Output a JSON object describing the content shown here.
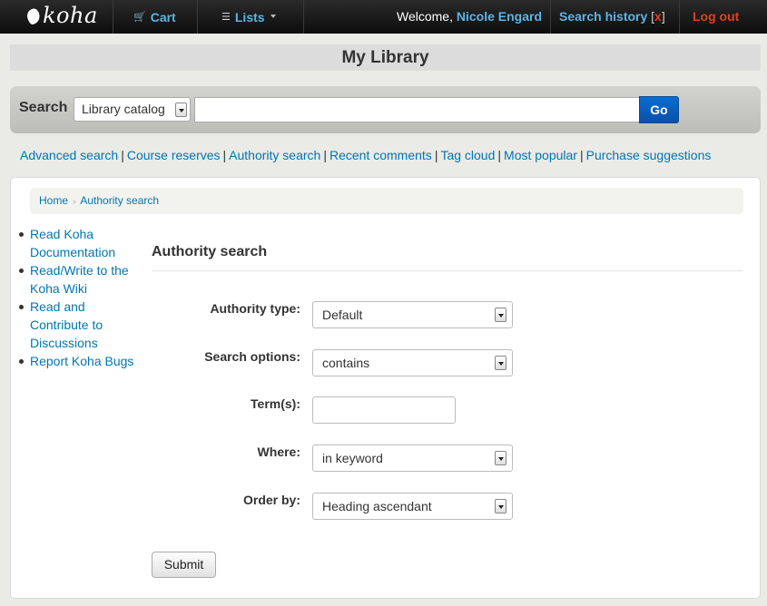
{
  "navbar": {
    "brand": "koha",
    "cart": "Cart",
    "lists": "Lists",
    "welcome_prefix": "Welcome, ",
    "user_name": "Nicole Engard",
    "search_history": "Search history",
    "search_history_open": "[",
    "search_history_clear": "x",
    "search_history_close": "]",
    "logout": "Log out"
  },
  "library_title": "My Library",
  "search": {
    "label": "Search",
    "scope": "Library catalog",
    "query": "",
    "go": "Go"
  },
  "links": {
    "items": [
      "Advanced search",
      "Course reserves",
      "Authority search",
      "Recent comments",
      "Tag cloud",
      "Most popular",
      "Purchase suggestions"
    ],
    "separator": "|"
  },
  "breadcrumb": {
    "home": "Home",
    "current": "Authority search",
    "separator": "›"
  },
  "sidebar": {
    "items": [
      "Read Koha Documentation",
      "Read/Write to the Koha Wiki",
      "Read and Contribute to Discussions",
      "Report Koha Bugs"
    ]
  },
  "form": {
    "title": "Authority search",
    "authority_type_label": "Authority type:",
    "authority_type_value": "Default",
    "search_options_label": "Search options:",
    "search_options_value": "contains",
    "terms_label": "Term(s):",
    "terms_value": "",
    "where_label": "Where:",
    "where_value": "in keyword",
    "order_label": "Order by:",
    "order_value": "Heading ascendant",
    "submit": "Submit"
  },
  "colors": {
    "link": "#0076b2",
    "nav_link": "#59b5e6",
    "logout": "#e63e1c",
    "go_button": "#0b6ccf"
  }
}
